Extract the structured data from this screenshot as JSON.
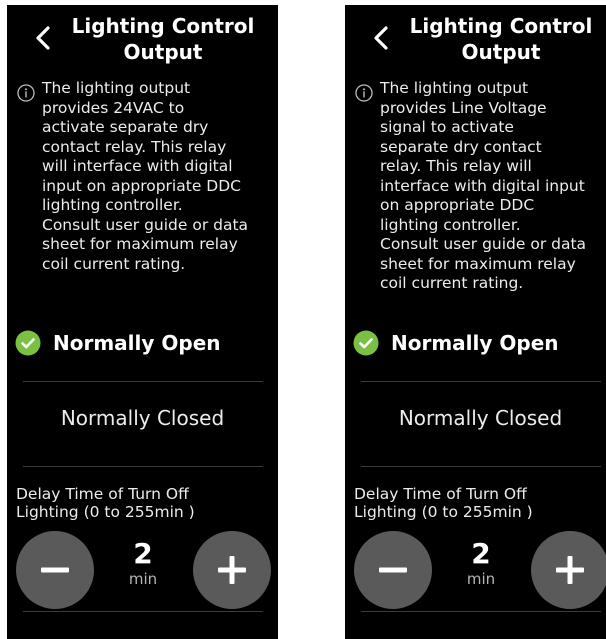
{
  "colors": {
    "background": "#000000",
    "check_green": "#7ac143",
    "stepper_gray": "#5a5a5a",
    "divider": "#3a3a3a"
  },
  "screens": [
    {
      "title": "Lighting Control Output",
      "description": "The lighting output\nprovides 24VAC to\nactivate separate dry\ncontact relay.  This relay\nwill interface with digital\ninput on appropriate DDC\nlighting controller.\nConsult user guide or data\nsheet for maximum relay\ncoil current rating.",
      "option_selected": "Normally Open",
      "option_other": "Normally Closed",
      "delay_label": "Delay Time of Turn Off\nLighting (0 to 255min )",
      "value": "2",
      "unit": "min",
      "icons": {
        "back": "chevron-left-icon",
        "info": "info-icon",
        "check": "check-circle-icon",
        "minus": "minus-icon",
        "plus": "plus-icon"
      }
    },
    {
      "title": "Lighting Control Output",
      "description": "The lighting output\nprovides Line Voltage\nsignal  to activate\nseparate dry contact\nrelay.  This relay  will\ninterface with digital input\non appropriate DDC\nlighting controller.\nConsult user guide or data\nsheet for maximum relay\ncoil current rating.",
      "option_selected": "Normally Open",
      "option_other": "Normally Closed",
      "delay_label": "Delay Time of Turn Off\nLighting (0 to 255min )",
      "value": "2",
      "unit": "min",
      "icons": {
        "back": "chevron-left-icon",
        "info": "info-icon",
        "check": "check-circle-icon",
        "minus": "minus-icon",
        "plus": "plus-icon"
      }
    }
  ]
}
